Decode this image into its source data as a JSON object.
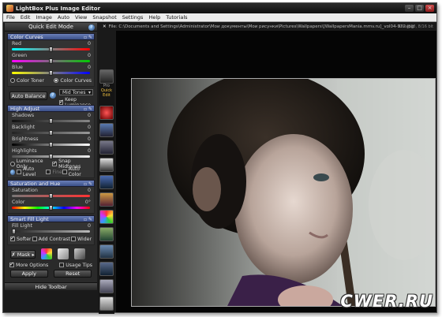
{
  "window": {
    "title": "LightBox Plus Image Editor"
  },
  "menu": [
    "File",
    "Edit",
    "Image",
    "Auto",
    "View",
    "Snapshot",
    "Settings",
    "Help",
    "Tutorials"
  ],
  "file": {
    "path": "File: C:\\Documents and Settings\\Administrator\\Мои документы\\Мои рисунки\\Pictures\\Wallpapers\\[WallpapersMania.mmv.ru]_vol04-922.jpg",
    "info": "850x638, 8/16 bit"
  },
  "panel": {
    "header": "Quick Edit Mode",
    "color_curves": {
      "title": "Color Curves",
      "sliders": [
        {
          "label": "Red",
          "value": "0"
        },
        {
          "label": "Green",
          "value": "0"
        },
        {
          "label": "Blue",
          "value": "0"
        }
      ],
      "modes": [
        "Color Toner",
        "Color Curves"
      ],
      "selected_mode": "Color Curves"
    },
    "auto_balance": {
      "label": "Auto Balance",
      "tones": "Mid Tones",
      "keep_luminance": "Keep Luminance"
    },
    "high_adjust": {
      "title": "High Adjust",
      "sliders": [
        {
          "label": "Shadows",
          "value": "0"
        },
        {
          "label": "Backlight",
          "value": "0"
        },
        {
          "label": "Brightness",
          "value": "0"
        },
        {
          "label": "Highlights",
          "value": "0"
        }
      ],
      "luminance_only": "Luminance Only",
      "snap_midtones": "Snap Midtones",
      "auto_level": "Auto Level",
      "fine": "Fine",
      "auto_color": "Auto Color"
    },
    "saturation_hue": {
      "title": "Saturation and Hue",
      "sliders": [
        {
          "label": "Saturation",
          "value": "0"
        },
        {
          "label": "Color",
          "value": "0°"
        }
      ]
    },
    "smart_fill": {
      "title": "Smart Fill Light",
      "sliders": [
        {
          "label": "Fill Light",
          "value": "0"
        }
      ],
      "options": [
        "Softer",
        "Add Contrast",
        "Wider"
      ]
    },
    "mask": "Mask",
    "more_options": "More Options",
    "usage_tips": "Usage Tips",
    "apply": "Apply",
    "reset": "Reset",
    "hide_toolbar": "Hide Toolbar"
  },
  "toolbar": {
    "pro_label": "Pro",
    "qe_label": "Quick Edit"
  },
  "watermark": "CWER.RU",
  "colors": {
    "section_head": "#4a5f98",
    "panel_bg": "#2a2a2a",
    "canvas_bg": "#050505"
  }
}
